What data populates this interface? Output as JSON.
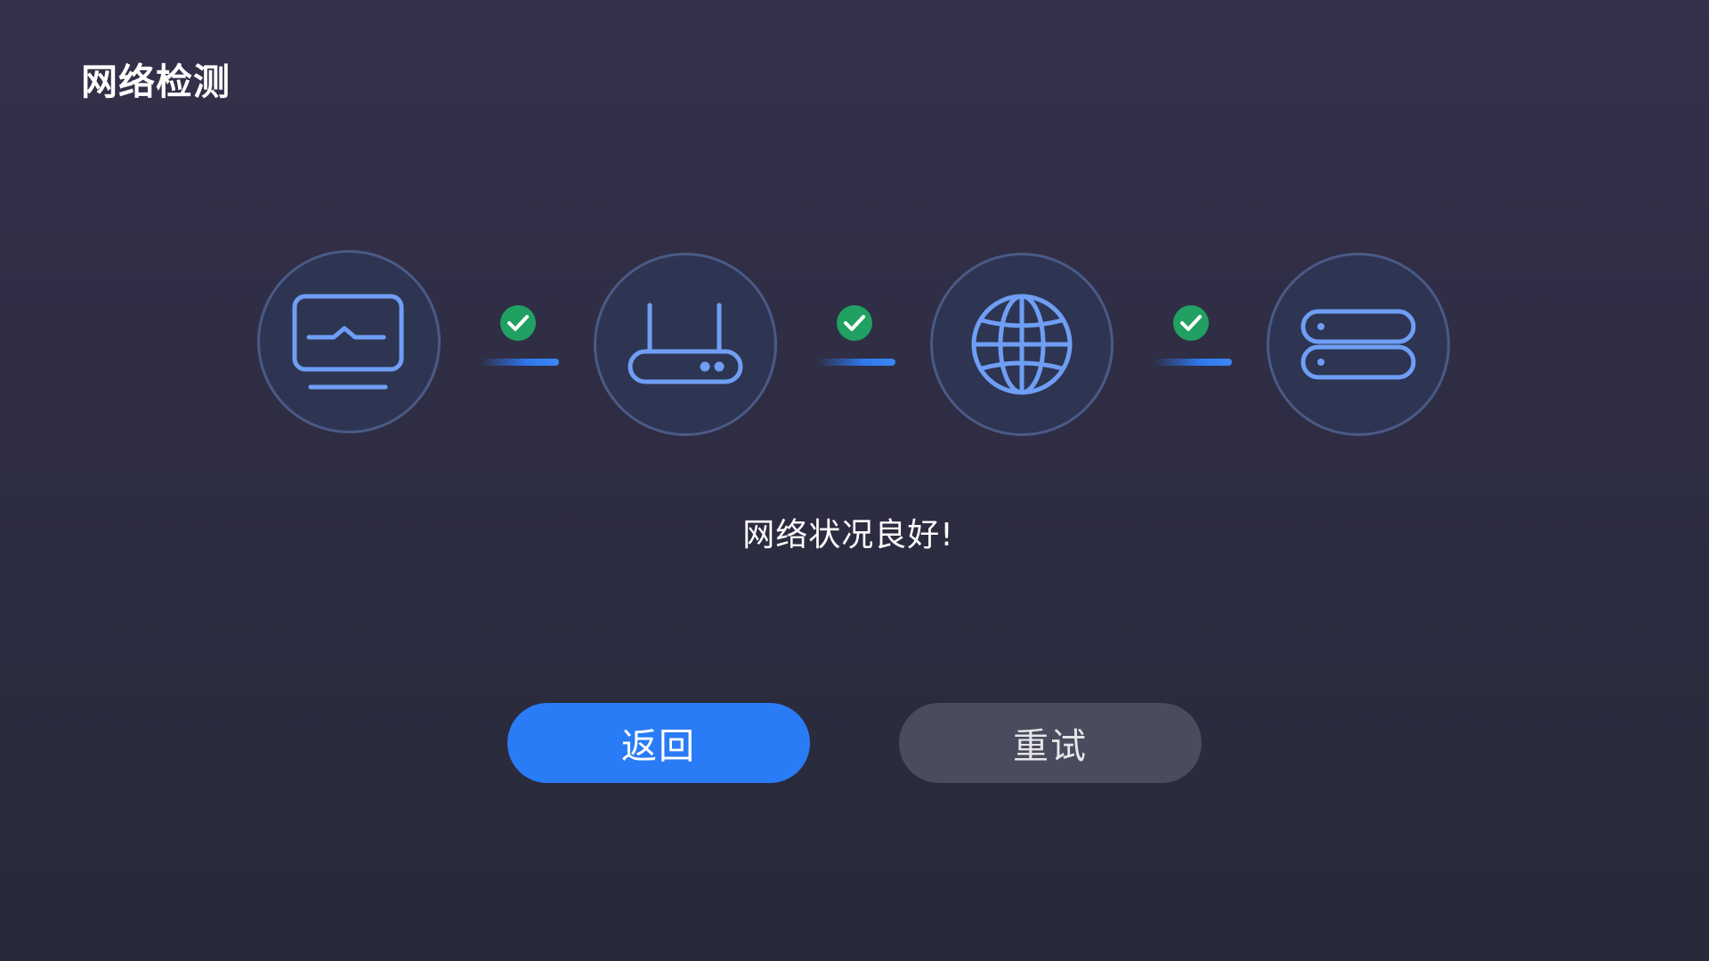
{
  "header": {
    "title": "网络检测"
  },
  "diagnostic": {
    "nodes": [
      {
        "id": "device",
        "icon": "monitor-icon"
      },
      {
        "id": "router",
        "icon": "router-icon"
      },
      {
        "id": "internet",
        "icon": "globe-icon"
      },
      {
        "id": "server",
        "icon": "server-icon"
      }
    ],
    "links": [
      {
        "status": "ok",
        "icon": "check-icon"
      },
      {
        "status": "ok",
        "icon": "check-icon"
      },
      {
        "status": "ok",
        "icon": "check-icon"
      }
    ],
    "status_text": "网络状况良好!"
  },
  "actions": {
    "back_label": "返回",
    "retry_label": "重试"
  },
  "colors": {
    "accent": "#2a7cf6",
    "success": "#20a062",
    "icon_stroke": "#6f9ef4",
    "secondary_button": "#4a4c5d"
  }
}
